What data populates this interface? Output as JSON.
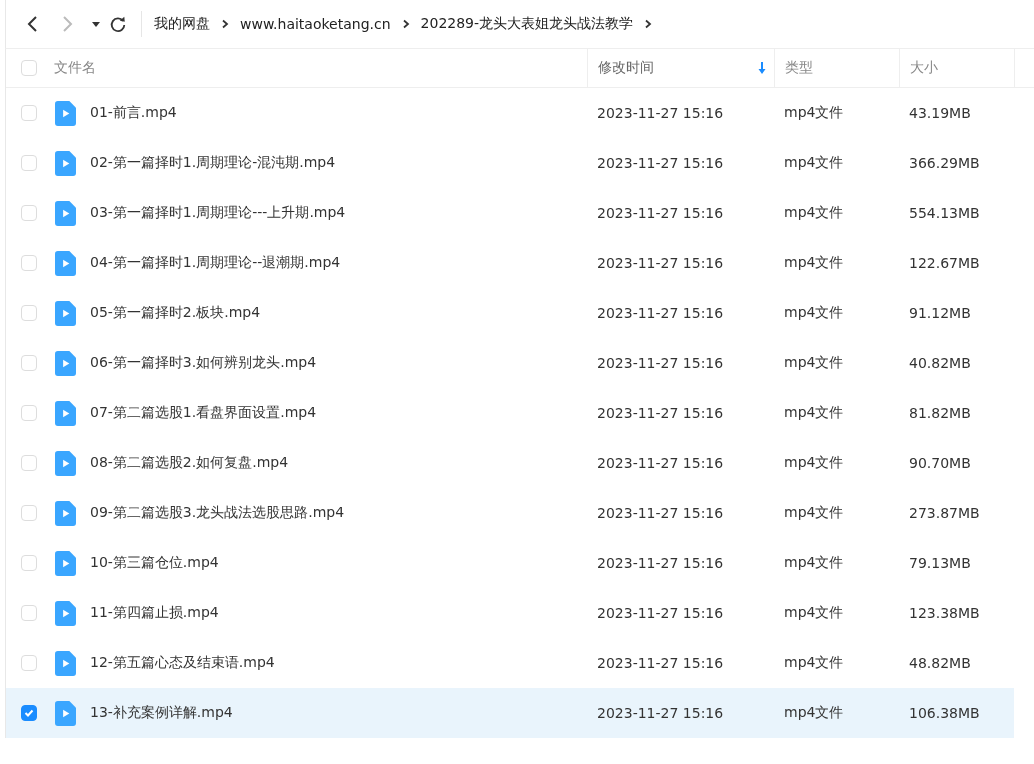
{
  "nav": {
    "back": {
      "disabled": false
    },
    "forward": {
      "disabled": true
    }
  },
  "breadcrumb": [
    "我的网盘",
    "www.haitaoketang.cn",
    "202289-龙头大表姐龙头战法教学"
  ],
  "table": {
    "select_all": {
      "checked": false
    },
    "columns": [
      {
        "label": "文件名",
        "sorted": false
      },
      {
        "label": "修改时间",
        "sorted": true
      },
      {
        "label": "类型",
        "sorted": false
      },
      {
        "label": "大小",
        "sorted": false
      }
    ],
    "rows": [
      {
        "name": "01-前言.mp4",
        "modified": "2023-11-27 15:16",
        "type": "mp4文件",
        "size": "43.19MB",
        "selected": false
      },
      {
        "name": "02-第一篇择时1.周期理论-混沌期.mp4",
        "modified": "2023-11-27 15:16",
        "type": "mp4文件",
        "size": "366.29MB",
        "selected": false
      },
      {
        "name": "03-第一篇择时1.周期理论---上升期.mp4",
        "modified": "2023-11-27 15:16",
        "type": "mp4文件",
        "size": "554.13MB",
        "selected": false
      },
      {
        "name": "04-第一篇择时1.周期理论--退潮期.mp4",
        "modified": "2023-11-27 15:16",
        "type": "mp4文件",
        "size": "122.67MB",
        "selected": false
      },
      {
        "name": "05-第一篇择时2.板块.mp4",
        "modified": "2023-11-27 15:16",
        "type": "mp4文件",
        "size": "91.12MB",
        "selected": false
      },
      {
        "name": "06-第一篇择时3.如何辨别龙头.mp4",
        "modified": "2023-11-27 15:16",
        "type": "mp4文件",
        "size": "40.82MB",
        "selected": false
      },
      {
        "name": "07-第二篇选股1.看盘界面设置.mp4",
        "modified": "2023-11-27 15:16",
        "type": "mp4文件",
        "size": "81.82MB",
        "selected": false
      },
      {
        "name": "08-第二篇选股2.如何复盘.mp4",
        "modified": "2023-11-27 15:16",
        "type": "mp4文件",
        "size": "90.70MB",
        "selected": false
      },
      {
        "name": "09-第二篇选股3.龙头战法选股思路.mp4",
        "modified": "2023-11-27 15:16",
        "type": "mp4文件",
        "size": "273.87MB",
        "selected": false
      },
      {
        "name": "10-第三篇仓位.mp4",
        "modified": "2023-11-27 15:16",
        "type": "mp4文件",
        "size": "79.13MB",
        "selected": false
      },
      {
        "name": "11-第四篇止损.mp4",
        "modified": "2023-11-27 15:16",
        "type": "mp4文件",
        "size": "123.38MB",
        "selected": false
      },
      {
        "name": "12-第五篇心态及结束语.mp4",
        "modified": "2023-11-27 15:16",
        "type": "mp4文件",
        "size": "48.82MB",
        "selected": false
      },
      {
        "name": "13-补充案例详解.mp4",
        "modified": "2023-11-27 15:16",
        "type": "mp4文件",
        "size": "106.38MB",
        "selected": true
      }
    ]
  }
}
